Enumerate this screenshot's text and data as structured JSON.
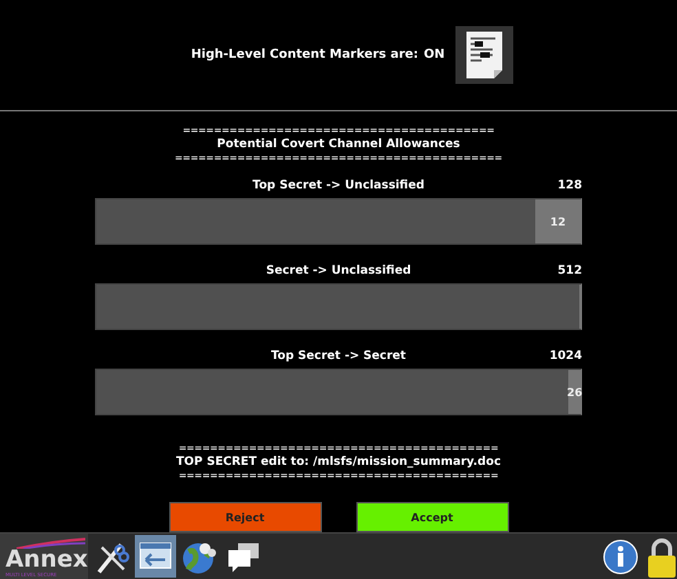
{
  "header": {
    "label": "High-Level Content Markers are:",
    "state": "ON"
  },
  "allowances": {
    "rule_top": "========================================",
    "title": "Potential Covert Channel Allowances",
    "rule_bottom": "==========================================",
    "channels": [
      {
        "name": "Top Secret  -> Unclassified",
        "limit": "128",
        "level": 0.094,
        "used": "12"
      },
      {
        "name": "Secret  -> Unclassified",
        "limit": "512",
        "level": 0.0
      },
      {
        "name": "Top Secret  -> Secret",
        "limit": "1024",
        "level": 0.025,
        "used": "26"
      }
    ]
  },
  "edit": {
    "rule_top": "=========================================",
    "text": "TOP SECRET edit to: /mlsfs/mission_summary.doc",
    "rule_bottom": "========================================="
  },
  "buttons": [
    {
      "label": "Reject",
      "kind": "reject"
    },
    {
      "label": "Accept",
      "kind": "accept"
    }
  ],
  "taskbar": {
    "logo": "Annex",
    "logo_sub": "MULTI LEVEL SECURE",
    "items": [
      {
        "kind": "tools",
        "selected": false
      },
      {
        "kind": "window",
        "selected": true
      },
      {
        "kind": "globe",
        "selected": false
      },
      {
        "kind": "chat",
        "selected": false
      }
    ]
  }
}
